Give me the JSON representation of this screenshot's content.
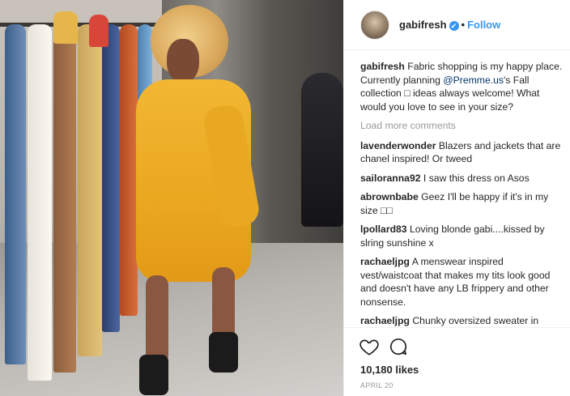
{
  "post": {
    "username": "gabifresh",
    "verified_badge": "✔",
    "separator": "•",
    "follow_label": "Follow",
    "caption_user": "gabifresh",
    "caption_text_a": "Fabric shopping is my happy place. Currently planning ",
    "caption_mention": "@Premme.us",
    "caption_text_b": "'s Fall collection ",
    "caption_glyph": "□",
    "caption_text_c": " ideas always welcome! What would you love to see in your size?",
    "load_more": "Load more comments",
    "comments": [
      {
        "user": "lavenderwonder",
        "text": "Blazers and jackets that are chanel inspired! Or tweed"
      },
      {
        "user": "sailoranna92",
        "text": "I saw this dress on Asos"
      },
      {
        "user": "abrownbabe",
        "text": "Geez I'll be happy if it's in my size □□"
      },
      {
        "user": "lpollard83",
        "text": "Loving blonde gabi....kissed by slring sunshine x"
      },
      {
        "user": "rachaeljpg",
        "text": "A menswear inspired vest/waistcoat that makes my tits look good and doesn't have any LB frippery and other nonsense."
      },
      {
        "user": "rachaeljpg",
        "text": "Chunky oversized sweater in cream or marigold or grimace purple"
      }
    ],
    "likes": "10,180 likes",
    "date": "APRIL 20"
  },
  "icons": {
    "like": "heart-icon",
    "comment": "comment-icon",
    "verified": "verified-badge-icon"
  },
  "colors": {
    "accent": "#3897f0",
    "mention": "#003569",
    "muted": "#999999",
    "text": "#262626",
    "dress": "#eaa720"
  }
}
